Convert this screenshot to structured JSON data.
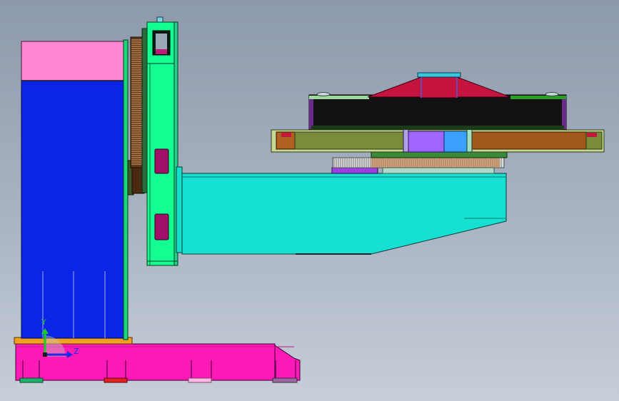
{
  "viewport": {
    "background_top": "#8d9aab",
    "background_bottom": "#c7ced8"
  },
  "triad": {
    "y_label": "Y",
    "z_label": "Z",
    "y_color": "#19c82a",
    "z_color": "#1a2be0"
  },
  "colors": {
    "column_blue": "#0a25e6",
    "column_pink_top": "#ff88d4",
    "base_magenta": "#ff1ab8",
    "plate_green": "#14ff92",
    "arm_cyan": "#16e0d2",
    "table_black": "#111111",
    "cover_crimson": "#c4143f",
    "gear_copper": "#c87a38",
    "rail_olive": "#7a8c3a",
    "rail_brown": "#a0581c",
    "block_violet": "#a064ff",
    "block_blue": "#3aa0ff",
    "slot_purple": "#a0106a"
  }
}
